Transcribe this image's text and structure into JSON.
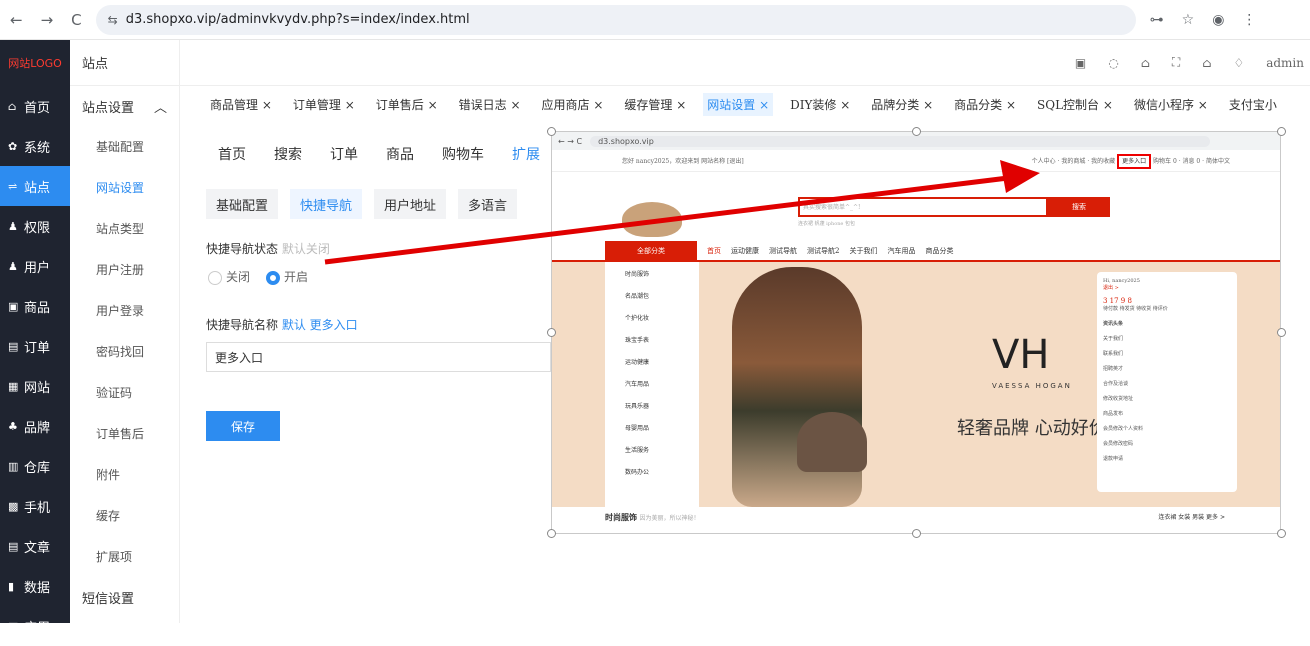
{
  "browser": {
    "url": "d3.shopxo.vip/adminvkvydv.php?s=index/index.html"
  },
  "sidebar": {
    "logo": "网站LOGO",
    "items": [
      {
        "label": "首页",
        "icon": "home-icon"
      },
      {
        "label": "系统",
        "icon": "gear-icon"
      },
      {
        "label": "站点",
        "icon": "site-icon"
      },
      {
        "label": "权限",
        "icon": "user-lock-icon"
      },
      {
        "label": "用户",
        "icon": "user-icon"
      },
      {
        "label": "商品",
        "icon": "goods-icon"
      },
      {
        "label": "订单",
        "icon": "order-icon"
      },
      {
        "label": "网站",
        "icon": "web-icon"
      },
      {
        "label": "品牌",
        "icon": "brand-icon"
      },
      {
        "label": "仓库",
        "icon": "warehouse-icon"
      },
      {
        "label": "手机",
        "icon": "mobile-icon"
      },
      {
        "label": "文章",
        "icon": "article-icon"
      },
      {
        "label": "数据",
        "icon": "chart-icon"
      },
      {
        "label": "应用",
        "icon": "app-icon"
      }
    ],
    "active_index": 2
  },
  "subnav": {
    "head": "站点",
    "group": "站点设置",
    "items": [
      "基础配置",
      "网站设置",
      "站点类型",
      "用户注册",
      "用户登录",
      "密码找回",
      "验证码",
      "订单售后",
      "附件",
      "缓存",
      "扩展项"
    ],
    "active_index": 1,
    "bottom_group": "短信设置"
  },
  "topbar": {
    "user": "admin"
  },
  "tabs": [
    {
      "label": "商品管理 ×"
    },
    {
      "label": "订单管理 ×"
    },
    {
      "label": "订单售后 ×"
    },
    {
      "label": "错误日志 ×"
    },
    {
      "label": "应用商店 ×"
    },
    {
      "label": "缓存管理 ×"
    },
    {
      "label": "网站设置 ×",
      "active": true
    },
    {
      "label": "DIY装修 ×"
    },
    {
      "label": "品牌分类 ×"
    },
    {
      "label": "商品分类 ×"
    },
    {
      "label": "SQL控制台 ×"
    },
    {
      "label": "微信小程序 ×"
    },
    {
      "label": "支付宝小"
    }
  ],
  "content": {
    "tabs": [
      "首页",
      "搜索",
      "订单",
      "商品",
      "购物车",
      "扩展"
    ],
    "active_tab": 5,
    "subtabs": [
      "基础配置",
      "快捷导航",
      "用户地址",
      "多语言"
    ],
    "active_subtab": 1,
    "status_label": "快捷导航状态",
    "status_default": "默认关闭",
    "radio_off": "关闭",
    "radio_on": "开启",
    "name_label": "快捷导航名称",
    "name_default": "默认 更多入口",
    "name_value": "更多入口",
    "save": "保存"
  },
  "screenshot": {
    "url": "d3.shopxo.vip",
    "welcome": "您好 nancy2025，欢迎来到 网站名称 [退出]",
    "top_links": [
      "个人中心",
      "我的商城",
      "我的收藏",
      "购物车 0",
      "消息 0",
      "简体中文"
    ],
    "more_entry": "更多入口",
    "search_placeholder": "其实搜索很简单^_^!",
    "search_button": "搜索",
    "hot_words": "连衣裙  帆蓬  iphone  包包",
    "all_categories": "全部分类",
    "nav": [
      "首页",
      "运动健康",
      "测试导航",
      "测试导航2",
      "关于我们",
      "汽车用品",
      "商品分类"
    ],
    "categories": [
      "时尚服饰",
      "名品潮包",
      "个护化妆",
      "珠宝手表",
      "运动健康",
      "汽车用品",
      "玩具乐器",
      "母婴用品",
      "生活服务",
      "数码办公"
    ],
    "brand": "VH",
    "brand_sub": "VAESSA HOGAN",
    "slogan": "轻奢品牌 心动好价",
    "user_greeting": "Hi, nancy2025",
    "user_logout": "退出 >",
    "user_counts": "3  17  9  8",
    "user_count_labels": "待付款 待发货 待收货 待评价",
    "news_title": "资讯头条",
    "news": [
      "关于我们",
      "联系我们",
      "招聘英才",
      "合作及洽谈",
      "修改收货地址",
      "商品发布",
      "会员修改个人资料",
      "会员修改密码",
      "退款申请"
    ],
    "floor_title": "时尚服饰",
    "floor_sub": "因为美丽，所以神秘！",
    "floor_links": "连衣裙  女装  男装  更多 >"
  },
  "colors": {
    "accent": "#2d8cf0",
    "sidebar_bg": "#1f2430",
    "shop_red": "#d81e06",
    "annotation_red": "#e00000"
  }
}
